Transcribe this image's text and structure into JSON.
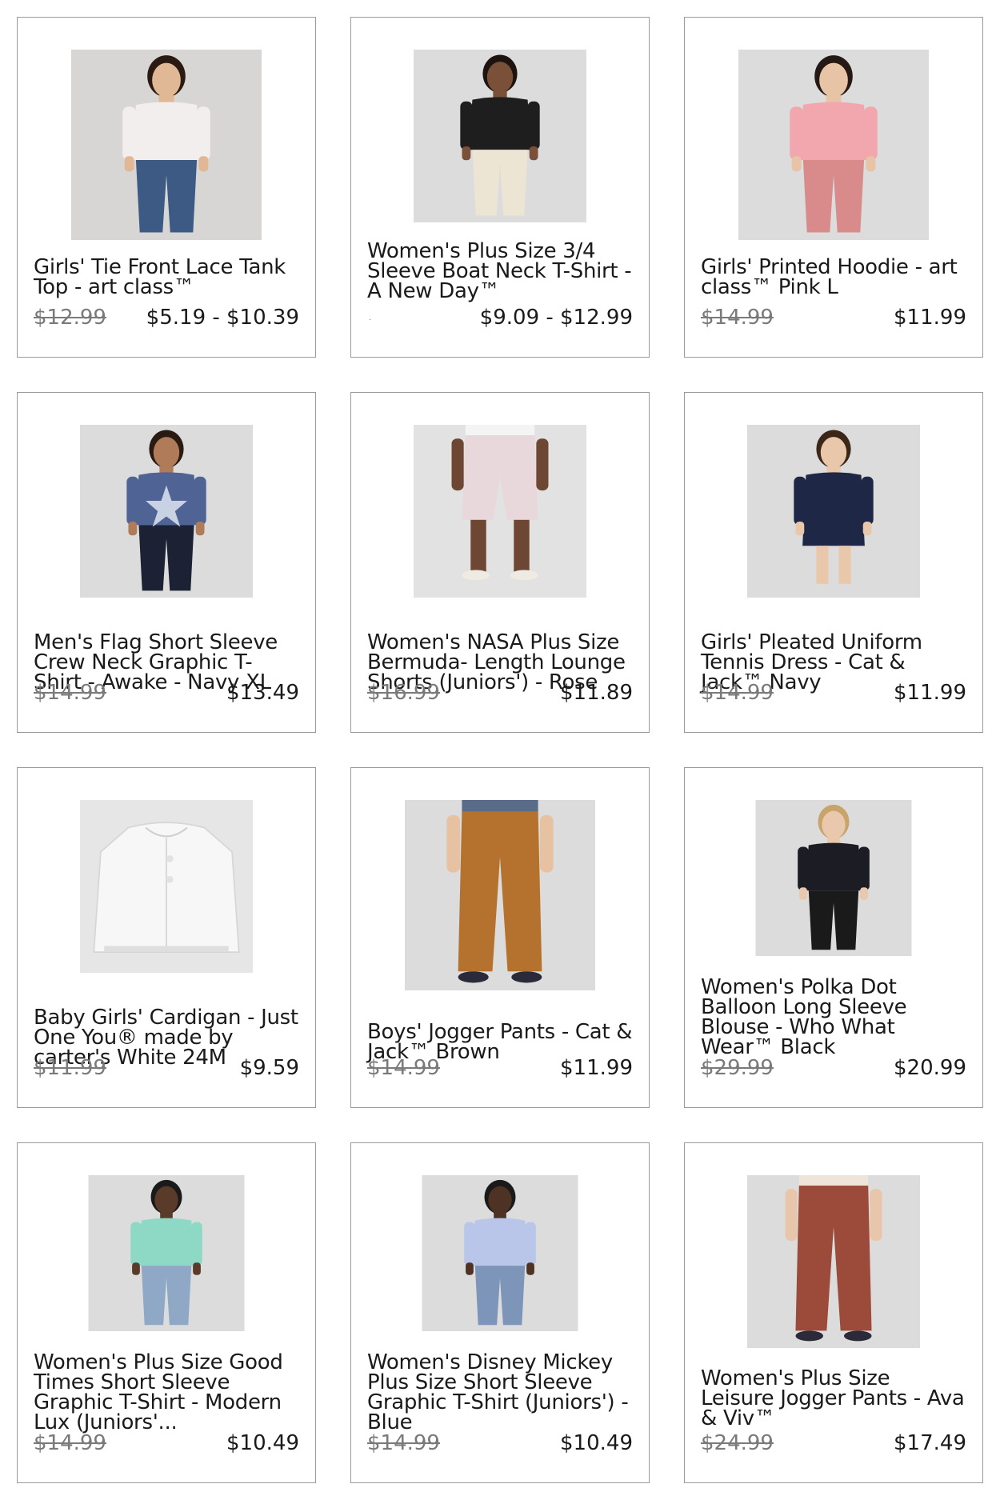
{
  "products": [
    {
      "title": "Girls' Tie Front Lace Tank\nTop - art class™",
      "old_price": "$12.99",
      "price": "$5.19 - $10.39",
      "image": "girl-white-lace-tank",
      "colors": {
        "bg": "#d8d6d4",
        "top": "#f2eeee",
        "bottom": "#3d5a85",
        "skin": "#e0b896",
        "hair": "#2a1a12"
      }
    },
    {
      "title": "Women's Plus Size 3/4\nSleeve Boat Neck T-Shirt -\n A New Day™",
      "old_price": "",
      "price": "$9.09 - $12.99",
      "image": "woman-black-boat-neck-tee",
      "colors": {
        "bg": "#dcdcdc",
        "top": "#1e1e1e",
        "bottom": "#ece5d4",
        "skin": "#7a5138",
        "hair": "#1d1410"
      }
    },
    {
      "title": "Girls' Printed Hoodie - art\n class™ Pink L",
      "old_price": "$14.99",
      "price": "$11.99",
      "image": "girl-pink-printed-hoodie",
      "colors": {
        "bg": "#dcdcdc",
        "top": "#f1a7ad",
        "bottom": "#d98a8a",
        "skin": "#e8c4a6",
        "hair": "#241914"
      }
    },
    {
      "title": "Men's Flag Short Sleeve\nCrew Neck Graphic T-\nShirt - Awake - Navy XL",
      "old_price": "$14.99",
      "price": "$13.49",
      "image": "man-navy-star-tee",
      "colors": {
        "bg": "#dcdcdc",
        "top": "#4f6494",
        "bottom": "#1c2233",
        "skin": "#b07b58",
        "hair": "#2a1b12"
      }
    },
    {
      "title": "Women's NASA Plus Size\nBermuda- Length Lounge\n Shorts (Juniors') - Rose",
      "old_price": "$16.99",
      "price": "$11.89",
      "image": "woman-rose-bermuda-shorts",
      "colors": {
        "bg": "#e2e2e2",
        "top": "#f4f4f4",
        "bottom": "#e8d8dc",
        "skin": "#6e4634",
        "hair": "#1a1a1a"
      }
    },
    {
      "title": "Girls' Pleated Uniform\nTennis Dress - Cat &\nJack™ Navy",
      "old_price": "$14.99",
      "price": "$11.99",
      "image": "girl-navy-tennis-dress",
      "colors": {
        "bg": "#dcdcdc",
        "top": "#1f2747",
        "bottom": "#1f2747",
        "skin": "#e9c7aa",
        "hair": "#3b2618"
      }
    },
    {
      "title": "Baby Girls' Cardigan - Just\n One You® made by\ncarter's White 24M",
      "old_price": "$11.99",
      "price": "$9.59",
      "image": "baby-white-cardigan",
      "colors": {
        "bg": "#e6e6e6",
        "top": "#f7f7f7",
        "bottom": "#f7f7f7",
        "skin": "#f7f7f7",
        "hair": "#e6e6e6"
      }
    },
    {
      "title": "Boys' Jogger Pants - Cat &\n Jack™ Brown",
      "old_price": "$14.99",
      "price": "$11.99",
      "image": "boys-brown-jogger-pants",
      "colors": {
        "bg": "#dcdcdc",
        "top": "#5a6b8a",
        "bottom": "#b5712e",
        "skin": "#e6c1a2",
        "hair": "#1e2a44"
      }
    },
    {
      "title": "Women's Polka Dot\nBalloon Long Sleeve\nBlouse - Who What\nWear™ Black",
      "old_price": "$29.99",
      "price": "$20.99",
      "image": "woman-black-polka-dot-blouse",
      "colors": {
        "bg": "#dcdcdc",
        "top": "#1c1d24",
        "bottom": "#1a1a1a",
        "skin": "#eac8ad",
        "hair": "#c9a46a"
      }
    },
    {
      "title": "Women's Plus Size Good\nTimes Short Sleeve\nGraphic T-Shirt - Modern\nLux (Juniors'...",
      "old_price": "$14.99",
      "price": "$10.49",
      "image": "woman-green-tie-dye-tee",
      "colors": {
        "bg": "#dcdcdc",
        "top": "#8ed9c6",
        "bottom": "#8fa8c6",
        "skin": "#5a3a28",
        "hair": "#1a1a1a"
      }
    },
    {
      "title": "Women's Disney Mickey\nPlus Size Short Sleeve\nGraphic T-Shirt (Juniors') -\n Blue",
      "old_price": "$14.99",
      "price": "$10.49",
      "image": "woman-blue-mickey-tee",
      "colors": {
        "bg": "#dcdcdc",
        "top": "#b9c6ea",
        "bottom": "#7d95b8",
        "skin": "#4e3224",
        "hair": "#1a1a1a"
      }
    },
    {
      "title": "Women's Plus Size\nLeisure Jogger Pants - Ava\n & Viv™",
      "old_price": "$24.99",
      "price": "$17.49",
      "image": "woman-brick-jogger-pants",
      "colors": {
        "bg": "#dcdcdc",
        "top": "#efe4da",
        "bottom": "#9c4a3a",
        "skin": "#e7c6ab",
        "hair": "#2a1a12"
      }
    }
  ]
}
